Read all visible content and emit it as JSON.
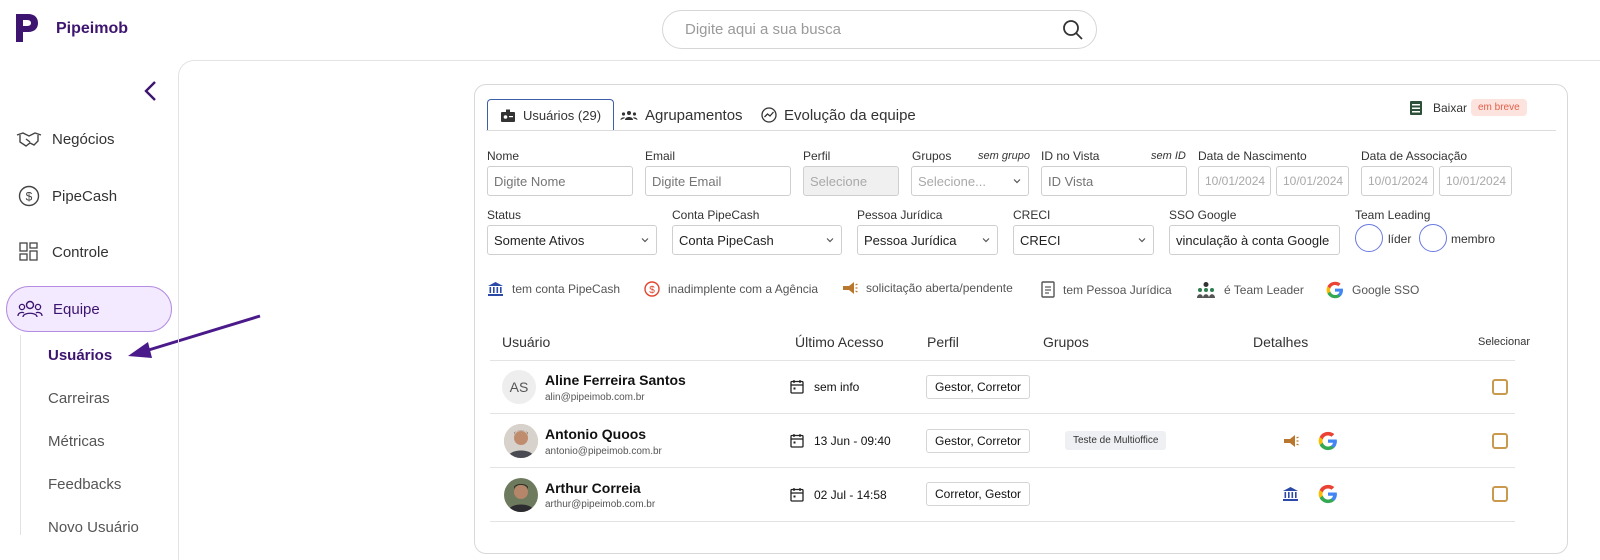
{
  "brand": {
    "name": "Pipeimob",
    "color": "#3d1470"
  },
  "search": {
    "placeholder": "Digite aqui a sua busca"
  },
  "sidebar": {
    "items": [
      {
        "label": "Negócios",
        "icon": "handshake-icon"
      },
      {
        "label": "PipeCash",
        "icon": "dollar-circle-icon"
      },
      {
        "label": "Controle",
        "icon": "dashboard-grid-icon"
      },
      {
        "label": "Equipe",
        "icon": "team-icon",
        "active": true
      }
    ],
    "subitems": [
      {
        "label": "Usuários",
        "active": true
      },
      {
        "label": "Carreiras"
      },
      {
        "label": "Métricas"
      },
      {
        "label": "Feedbacks"
      },
      {
        "label": "Novo Usuário"
      }
    ]
  },
  "tabs": [
    {
      "label": "Usuários (29)",
      "icon": "id-badge-icon",
      "active": true
    },
    {
      "label": "Agrupamentos",
      "icon": "group-icon"
    },
    {
      "label": "Evolução da equipe",
      "icon": "trend-icon"
    }
  ],
  "download": {
    "label": "Baixar",
    "badge": "em breve"
  },
  "filters": {
    "nome": {
      "label": "Nome",
      "placeholder": "Digite Nome"
    },
    "email": {
      "label": "Email",
      "placeholder": "Digite Email"
    },
    "perfil": {
      "label": "Perfil",
      "value": "Selecione"
    },
    "grupos": {
      "label": "Grupos",
      "note": "sem grupo",
      "value": "Selecione..."
    },
    "id_vista": {
      "label": "ID no Vista",
      "note": "sem ID",
      "placeholder": "ID Vista"
    },
    "nascimento": {
      "label": "Data de Nascimento",
      "from": "10/01/2024",
      "to": "10/01/2024"
    },
    "associacao": {
      "label": "Data de Associação",
      "from": "10/01/2024",
      "to": "10/01/2024"
    },
    "status": {
      "label": "Status",
      "value": "Somente Ativos"
    },
    "conta_pipecash": {
      "label": "Conta PipeCash",
      "value": "Conta PipeCash"
    },
    "pessoa_juridica": {
      "label": "Pessoa Jurídica",
      "value": "Pessoa Jurídica"
    },
    "creci": {
      "label": "CRECI",
      "value": "CRECI"
    },
    "sso_google": {
      "label": "SSO Google",
      "value": "vinculação à conta Google"
    },
    "team_leading": {
      "label": "Team Leading",
      "lider": "líder",
      "membro": "membro"
    }
  },
  "legend": [
    {
      "label": "tem conta PipeCash",
      "icon": "bank-icon",
      "color": "#2b4aa8"
    },
    {
      "label": "inadimplente com a Agência",
      "icon": "dollar-alert-icon",
      "color": "#e0452e"
    },
    {
      "label": "solicitação aberta/pendente",
      "icon": "megaphone-icon",
      "color": "#b8772c"
    },
    {
      "label": "tem Pessoa Jurídica",
      "icon": "document-icon",
      "color": "#555555"
    },
    {
      "label": "é Team Leader",
      "icon": "team-leader-icon",
      "color": "#2e7d4f"
    },
    {
      "label": "Google SSO",
      "icon": "google-icon",
      "color": "#4285f4"
    }
  ],
  "table": {
    "columns": {
      "usuario": "Usuário",
      "acesso": "Último Acesso",
      "perfil": "Perfil",
      "grupos": "Grupos",
      "detalhes": "Detalhes",
      "selecionar": "Selecionar"
    },
    "rows": [
      {
        "initials": "AS",
        "name": "Aline Ferreira Santos",
        "email": "alin@pipeimob.com.br",
        "access": "sem info",
        "perfil": "Gestor, Corretor",
        "grupo": "",
        "details": []
      },
      {
        "initials": "",
        "name": "Antonio Quoos",
        "email": "antonio@pipeimob.com.br",
        "access": "13 Jun - 09:40",
        "perfil": "Gestor, Corretor",
        "grupo": "Teste de Multioffice",
        "details": [
          "megaphone-icon",
          "google-icon"
        ]
      },
      {
        "initials": "",
        "name": "Arthur Correia",
        "email": "arthur@pipeimob.com.br",
        "access": "02 Jul - 14:58",
        "perfil": "Corretor, Gestor",
        "grupo": "",
        "details": [
          "bank-icon",
          "google-icon"
        ]
      }
    ]
  }
}
